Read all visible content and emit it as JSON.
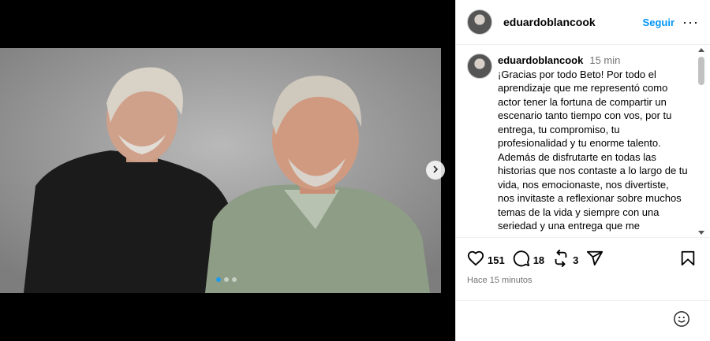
{
  "post": {
    "author": "eduardoblancook",
    "follow_label": "Seguir",
    "more_label": "···",
    "caption": {
      "user": "eduardoblancook",
      "time": "15 min",
      "text": "¡Gracias por todo Beto! Por todo el aprendizaje que me representó como actor tener la fortuna de compartir un escenario tanto tiempo con vos, por tu entrega, tu compromiso, tu profesionalidad y tu enorme talento. Además de disfrutarte en todas las historias que nos contaste a lo largo de tu vida, nos emocionaste, nos divertiste, nos invitaste a reflexionar sobre muchos temas de la vida y siempre con una seriedad y una entrega que me"
    },
    "likes": "151",
    "comments": "18",
    "reposts": "3",
    "timestamp": "Hace 15 minutos",
    "comment_placeholder": ""
  },
  "carousel": {
    "total": 3,
    "active": 1
  },
  "icons": {
    "like": "heart-icon",
    "comment": "comment-bubble-icon",
    "repost": "repost-icon",
    "share": "paper-plane-icon",
    "save": "bookmark-icon",
    "emoji": "smiley-icon",
    "next": "chevron-right-icon"
  },
  "colors": {
    "accent": "#0095f6",
    "muted": "#737373",
    "dot_active": "#1d9bf0"
  }
}
